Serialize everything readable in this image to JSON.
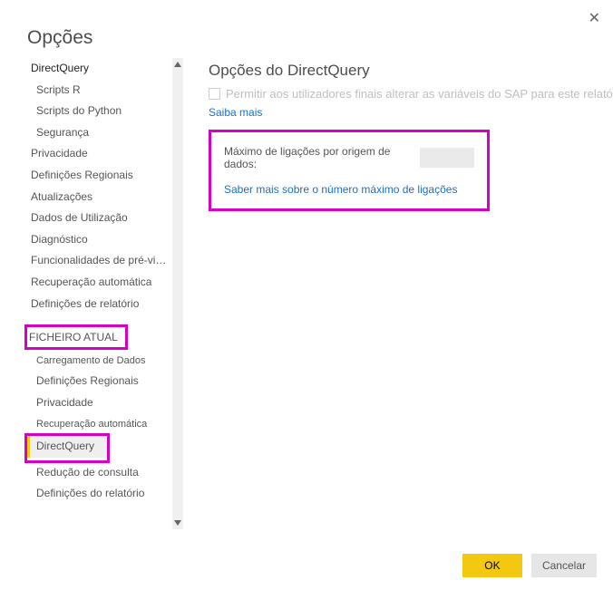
{
  "dialog": {
    "title": "Opções",
    "close": "✕"
  },
  "sidebar": {
    "section1": {
      "items": [
        "DirectQuery",
        "Scripts R",
        "Scripts do Python",
        "Segurança",
        "Privacidade",
        "Definições Regionais",
        "Atualizações",
        "Dados de Utilização",
        "Diagnóstico",
        "Funcionalidades de pré-visualização",
        "Recuperação automática",
        "Definições de relatório"
      ]
    },
    "section2": {
      "header": "FICHEIRO ATUAL",
      "items": [
        "Carregamento de Dados",
        "Definições Regionais",
        "Privacidade",
        "Recuperação automática",
        "DirectQuery",
        "Redução de consulta",
        "Definições do relatório"
      ]
    }
  },
  "panel": {
    "title": "Opções do DirectQuery",
    "checkbox_label": "Permitir aos utilizadores finais alterar as variáveis do SAP para este relatório",
    "learn_more": "Saiba mais",
    "max_conn_label": "Máximo de ligações por origem de dados:",
    "max_conn_value": "",
    "max_conn_link": "Saber mais sobre o número máximo de ligações"
  },
  "footer": {
    "ok": "OK",
    "cancel": "Cancelar"
  }
}
